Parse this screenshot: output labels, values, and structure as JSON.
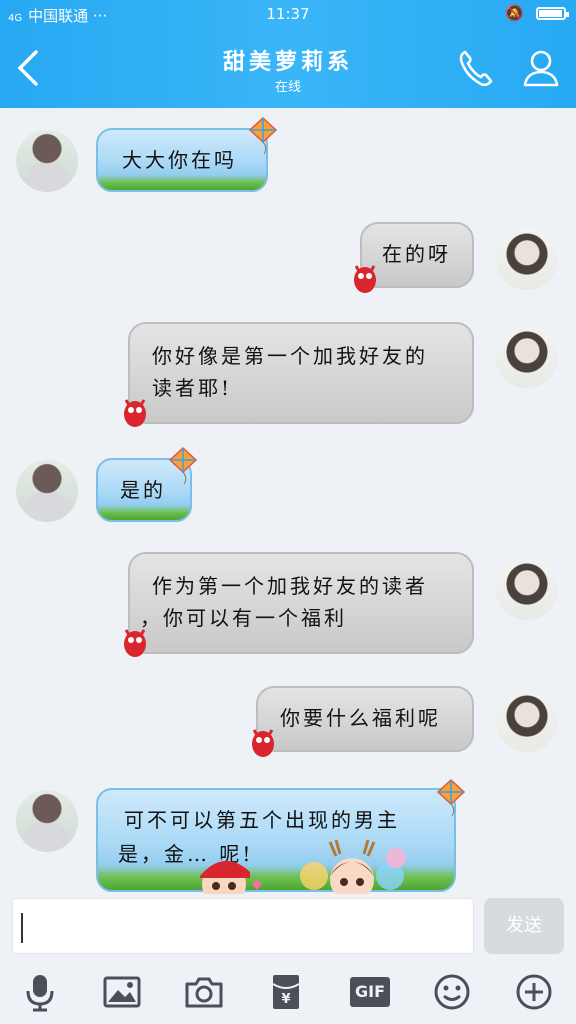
{
  "status_bar": {
    "network": "4G",
    "carrier": "中国联通 ···",
    "time": "11:37",
    "battery_level": 0.9
  },
  "header": {
    "title": "甜美萝莉系",
    "subtitle": "在线",
    "back_icon": "chevron-left-icon",
    "call_icon": "phone-icon",
    "profile_icon": "user-icon"
  },
  "messages": [
    {
      "side": "left",
      "lines": [
        "大大你在吗"
      ]
    },
    {
      "side": "right",
      "lines": [
        "在的呀"
      ]
    },
    {
      "side": "right",
      "lines": [
        "你好像是第一个加我好友的",
        "读者耶!"
      ]
    },
    {
      "side": "left",
      "lines": [
        "是的"
      ]
    },
    {
      "side": "right",
      "lines": [
        "作为第一个加我好友的读者",
        "，你可以有一个福利"
      ]
    },
    {
      "side": "right",
      "lines": [
        "你要什么福利呢"
      ]
    },
    {
      "side": "left",
      "lines": [
        "可不可以第五个出现的男主",
        "是，金… 呢!"
      ]
    }
  ],
  "input": {
    "value": "",
    "placeholder": ""
  },
  "send_label": "发送",
  "toolbar": [
    {
      "icon": "microphone-icon"
    },
    {
      "icon": "image-icon"
    },
    {
      "icon": "camera-icon"
    },
    {
      "icon": "red-packet-icon"
    },
    {
      "icon": "gif-icon",
      "label": "GIF"
    },
    {
      "icon": "emoji-icon"
    },
    {
      "icon": "plus-icon"
    }
  ],
  "colors": {
    "header": "#2aaaf3",
    "bubble_blue": "#a9d9f6",
    "bubble_gray": "#d4d4d4"
  }
}
